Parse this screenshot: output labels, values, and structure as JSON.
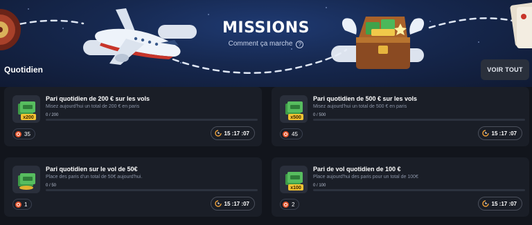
{
  "banner": {
    "title": "MISSIONS",
    "how_it_works": "Comment ça marche",
    "help_icon": "?"
  },
  "section": {
    "title": "Quotidien",
    "see_all": "VOIR TOUT"
  },
  "colors": {
    "accent": "#f0a23a",
    "card_bg": "#1a1e27",
    "page_bg": "#12151c",
    "coin": "#e4532b"
  },
  "missions": [
    {
      "title": "Pari quotidien de 200 € sur les vols",
      "description": "Misez aujourd'hui un total de 200 € en paris",
      "progress_text": "0 / 200",
      "progress": 0,
      "badge": "x200",
      "reward": "35",
      "timer": "15 :17 :07"
    },
    {
      "title": "Pari quotidien de 500 € sur les vols",
      "description": "Misez aujourd'hui un total de 500 € en paris",
      "progress_text": "0 / 500",
      "progress": 0,
      "badge": "x500",
      "reward": "45",
      "timer": "15 :17 :07"
    },
    {
      "title": "Pari quotidien sur le vol de 50€",
      "description": "Place des paris d'un total de 50€ aujourd'hui.",
      "progress_text": "0 / 50",
      "progress": 0,
      "badge": "",
      "reward": "1",
      "timer": "15 :17 :07"
    },
    {
      "title": "Pari de vol quotidien de 100 €",
      "description": "Place aujourd'hui des paris pour un total de 100€",
      "progress_text": "0 / 100",
      "progress": 0,
      "badge": "x100",
      "reward": "2",
      "timer": "15 :17 :07"
    }
  ]
}
